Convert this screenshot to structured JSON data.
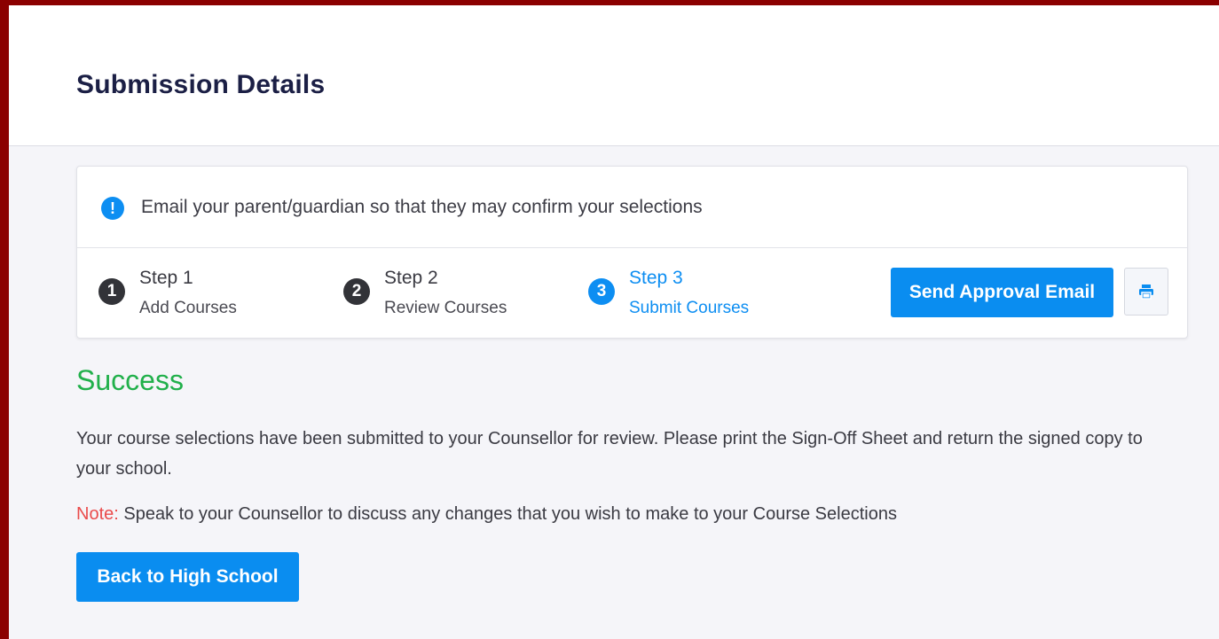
{
  "header": {
    "title": "Submission Details"
  },
  "info": {
    "icon": "exclamation-info-icon",
    "icon_glyph": "!",
    "message": "Email your parent/guardian so that they may confirm your selections"
  },
  "steps": [
    {
      "number": "1",
      "title": "Step 1",
      "subtitle": "Add Courses",
      "active": false
    },
    {
      "number": "2",
      "title": "Step 2",
      "subtitle": "Review Courses",
      "active": false
    },
    {
      "number": "3",
      "title": "Step 3",
      "subtitle": "Submit Courses",
      "active": true
    }
  ],
  "actions": {
    "send_label": "Send Approval Email",
    "print_icon": "printer-icon"
  },
  "success": {
    "title": "Success",
    "message": "Your course selections have been submitted to your Counsellor for review. Please print the Sign-Off Sheet and return the signed copy to your school.",
    "note_label": "Note:",
    "note_text": " Speak to your Counsellor to discuss any changes that you wish to make to your Course Selections",
    "back_label": "Back to High School"
  },
  "colors": {
    "accent": "#0a8df0",
    "success": "#21b04b",
    "note": "#ea4b4b",
    "frame": "#8b0000"
  }
}
